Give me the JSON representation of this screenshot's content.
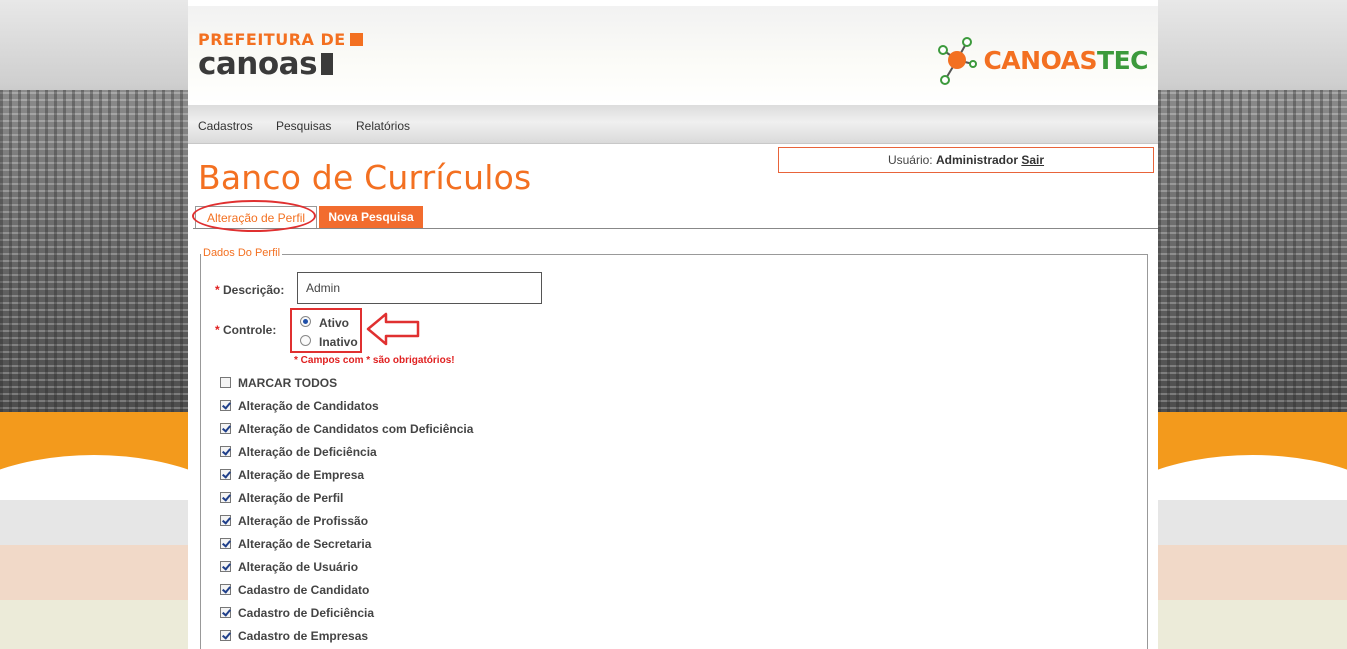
{
  "logo_prefeitura": {
    "line1": "PREFEITURA DE",
    "line2": "canoas"
  },
  "logo_canoastec": {
    "part1": "CANOAS",
    "part2": "TEC"
  },
  "menu": {
    "items": [
      "Cadastros",
      "Pesquisas",
      "Relatórios"
    ]
  },
  "user": {
    "label": "Usuário:",
    "name": "Administrador",
    "logout": "Sair"
  },
  "page_title": "Banco de Currículos",
  "tabs": [
    {
      "label": "Alteração de Perfil",
      "active": true
    },
    {
      "label": "Nova Pesquisa",
      "active": false
    }
  ],
  "form": {
    "legend": "Dados Do Perfil",
    "descricao": {
      "required": "*",
      "label": "Descrição:",
      "value": "Admin"
    },
    "controle": {
      "required": "*",
      "label": "Controle:",
      "options": [
        {
          "label": "Ativo",
          "checked": true
        },
        {
          "label": "Inativo",
          "checked": false
        }
      ]
    },
    "required_note": "* Campos com * são obrigatórios!",
    "checkboxes": [
      {
        "label": "MARCAR TODOS",
        "checked": false
      },
      {
        "label": "Alteração de Candidatos",
        "checked": true
      },
      {
        "label": "Alteração de Candidatos com Deficiência",
        "checked": true
      },
      {
        "label": "Alteração de Deficiência",
        "checked": true
      },
      {
        "label": "Alteração de Empresa",
        "checked": true
      },
      {
        "label": "Alteração de Perfil",
        "checked": true
      },
      {
        "label": "Alteração de Profissão",
        "checked": true
      },
      {
        "label": "Alteração de Secretaria",
        "checked": true
      },
      {
        "label": "Alteração de Usuário",
        "checked": true
      },
      {
        "label": "Cadastro de Candidato",
        "checked": true
      },
      {
        "label": "Cadastro de Deficiência",
        "checked": true
      },
      {
        "label": "Cadastro de Empresas",
        "checked": true
      }
    ]
  },
  "colors": {
    "brand_orange": "#f37021",
    "brand_green": "#3c9a3c",
    "annotation_red": "#e03030"
  }
}
